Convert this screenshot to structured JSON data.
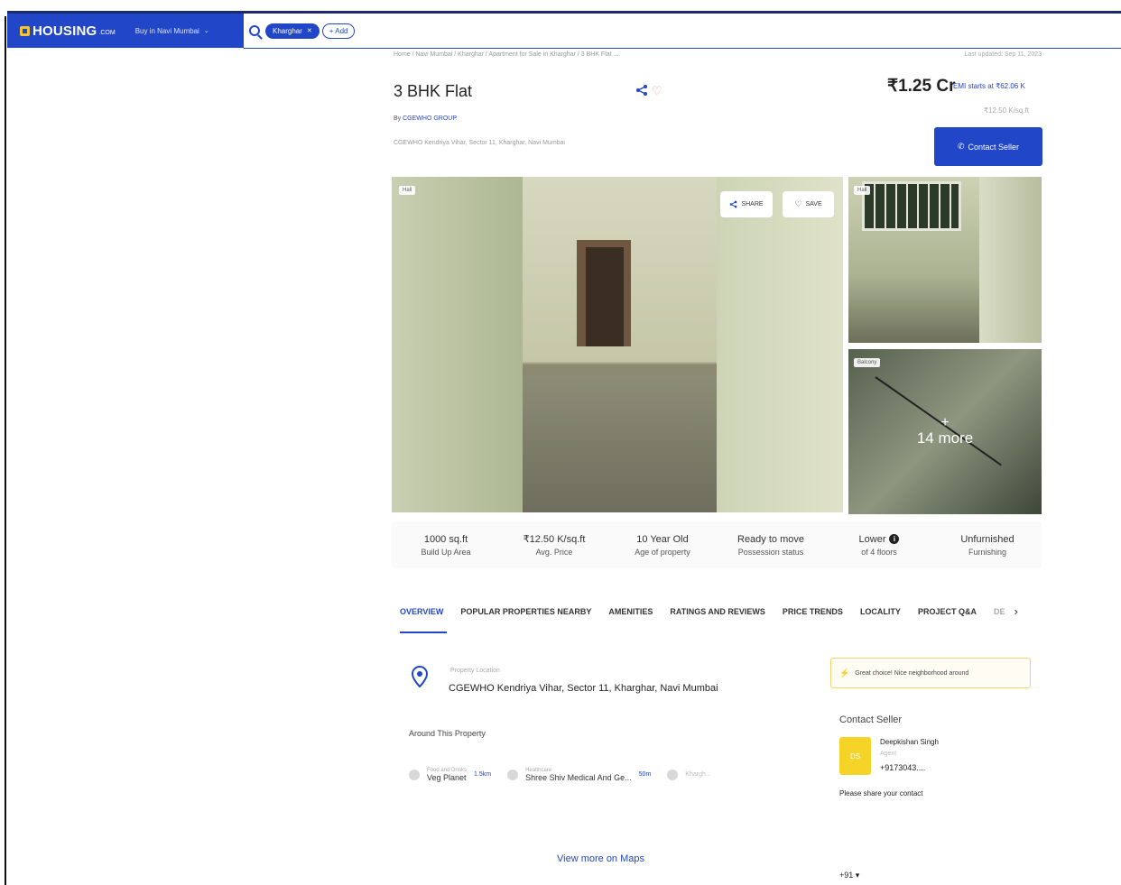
{
  "header": {
    "logo_text": "HOUSING",
    "logo_sub": ".COM",
    "city": "Buy in Navi Mumbai",
    "chip": "Kharghar",
    "add_label": "+ Add"
  },
  "breadcrumb": "Home / Navi Mumbai / Kharghar / Apartment for Sale in Kharghar / 3 BHK Flat ...",
  "updated": "Last updated: Sep 11, 2023",
  "listing": {
    "title": "3 BHK Flat",
    "by_prefix": "By",
    "builder": "CGEWHO GROUP",
    "address_short": "CGEWHO Kendriya Vihar, Sector 11, Kharghar, Navi Mumbai",
    "price": "₹1.25 Cr",
    "emi": "EMI starts at ₹62.06 K",
    "price_per_sqft": "₹12.50 K/sq.ft",
    "contact_label": "Contact Seller"
  },
  "gallery": {
    "tag_main": "Hall",
    "tag_side1": "Hall",
    "tag_side2": "Balcony",
    "share_label": "SHARE",
    "save_label": "SAVE",
    "more_plus": "+",
    "more_label": "14 more"
  },
  "stats": [
    {
      "value": "1000 sq.ft",
      "label": "Build Up Area"
    },
    {
      "value": "₹12.50 K/sq.ft",
      "label": "Avg. Price"
    },
    {
      "value": "10 Year Old",
      "label": "Age of property"
    },
    {
      "value": "Ready to move",
      "label": "Possession status"
    },
    {
      "value": "Lower",
      "label": "of 4 floors"
    },
    {
      "value": "Unfurnished",
      "label": "Furnishing"
    }
  ],
  "tabs": [
    "OVERVIEW",
    "POPULAR PROPERTIES NEARBY",
    "AMENITIES",
    "RATINGS AND REVIEWS",
    "PRICE TRENDS",
    "LOCALITY",
    "PROJECT Q&A"
  ],
  "tab_more": "DE",
  "location": {
    "label": "Property Location",
    "value": "CGEWHO Kendriya Vihar, Sector 11, Kharghar, Navi Mumbai"
  },
  "around": {
    "title": "Around This Property",
    "items": [
      {
        "category": "Food and Drinks",
        "name": "Veg Planet",
        "distance": "1.5km"
      },
      {
        "category": "Healthcare",
        "name": "Shree Shiv Medical And Ge...",
        "distance": "50m"
      }
    ],
    "faded": "Khargh..."
  },
  "view_maps": "View more on Maps",
  "notice": "Great choice! Nice neighborhood around",
  "contact": {
    "title": "Contact Seller",
    "avatar": "DS",
    "name": "Deepkishan Singh",
    "role": "Agent",
    "phone": "+9173043....",
    "share_prompt": "Please share your contact",
    "country_code": "+91 ▾"
  },
  "colors": {
    "brand": "#2146c7",
    "accent": "#f5d327",
    "text": "#222222"
  }
}
